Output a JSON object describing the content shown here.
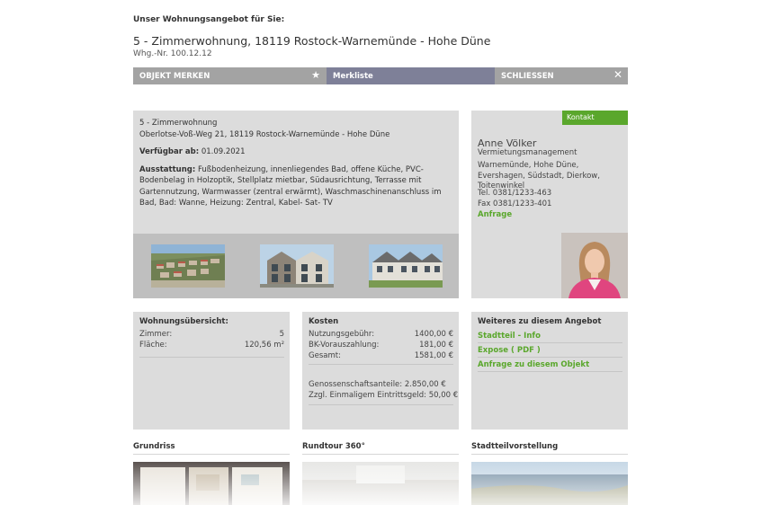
{
  "header": {
    "intro": "Unser Wohnungsangebot für Sie:",
    "title": "5 - Zimmerwohnung, 18119 Rostock-Warnemünde - Hohe Düne",
    "subnr": "Whg.-Nr. 100.12.12"
  },
  "toolbar": {
    "merken": "OBJEKT MERKEN",
    "merkliste": "Merkliste",
    "close": "SCHLIESSEN",
    "star_icon": "star-icon",
    "close_icon": "close-icon"
  },
  "main": {
    "type": "5 - Zimmerwohnung",
    "address": "Oberlotse-Voß-Weg 21, 18119 Rostock-Warnemünde - Hohe Düne",
    "available_label": "Verfügbar ab:",
    "available_value": "01.09.2021",
    "equipment_label": "Ausstattung:",
    "equipment_value": "Fußbodenheizung, innenliegendes Bad, offene Küche, PVC-Bodenbelag in Holzoptik, Stellplatz mietbar, Südausrichtung, Terrasse mit Gartennutzung, Warmwasser (zentral erwärmt), Waschmaschinenanschluss im Bad, Bad: Wanne, Heizung: Zentral, Kabel- Sat- TV"
  },
  "contact": {
    "tag": "Kontakt",
    "name": "Anne Völker",
    "role": "Vermietungsmanagement",
    "area": "Warnemünde, Hohe Düne, Evershagen, Südstadt, Dierkow, Toitenwinkel",
    "tel": "Tel. 0381/1233-463",
    "fax": "Fax 0381/1233-401",
    "anfrage": "Anfrage"
  },
  "overview": {
    "title": "Wohnungsübersicht:",
    "rooms_label": "Zimmer:",
    "rooms_value": "5",
    "area_label": "Fläche:",
    "area_value": "120,56 m²"
  },
  "costs": {
    "title": "Kosten",
    "usage_label": "Nutzungsgebühr:",
    "usage_value": "1400,00 €",
    "bk_label": "BK-Vorauszahlung:",
    "bk_value": "181,00 €",
    "total_label": "Gesamt:",
    "total_value": "1581,00 €",
    "shares": "Genossenschaftsanteile: 2.850,00 €",
    "entry": "Zzgl. Einmaligem Eintrittsgeld: 50,00 €"
  },
  "more": {
    "title": "Weiteres zu diesem Angebot",
    "links": [
      "Stadtteil - Info",
      "Expose ( PDF )",
      "Anfrage zu diesem Objekt"
    ]
  },
  "sections": {
    "grundriss": "Grundriss",
    "rundtour": "Rundtour 360°",
    "stadtteil": "Stadtteilvorstellung"
  },
  "colors": {
    "accent_green": "#5aa72c",
    "toolbar_gray": "#a3a3a3",
    "toolbar_active": "#7e8098",
    "panel_gray": "#dcdcdc"
  }
}
